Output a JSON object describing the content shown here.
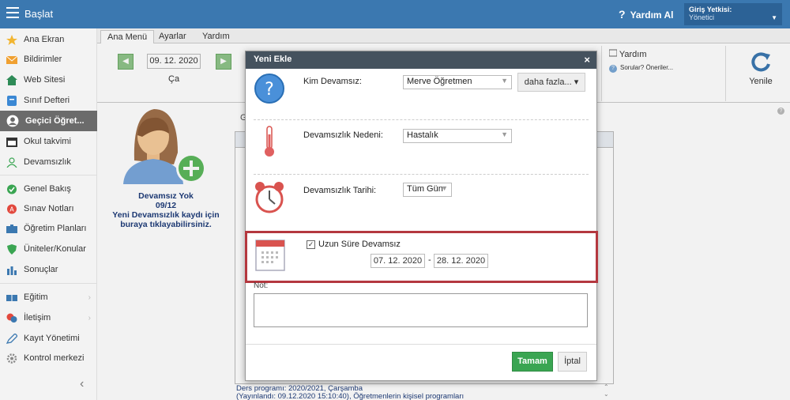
{
  "app": {
    "title": "Başlat",
    "help": "Yardım Al",
    "role_label": "Giriş Yetkisi:",
    "role_value": "Yönetici"
  },
  "sidebar": {
    "items": [
      {
        "label": "Ana Ekran",
        "icon": "star-icon"
      },
      {
        "label": "Bildirimler",
        "icon": "mail-icon"
      },
      {
        "label": "Web Sitesi",
        "icon": "home-icon"
      },
      {
        "label": "Sınıf Defteri",
        "icon": "notebook-icon"
      },
      {
        "label": "Geçici Öğret...",
        "icon": "person-icon"
      },
      {
        "label": "Okul takvimi",
        "icon": "calendar-icon"
      },
      {
        "label": "Devamsızlık",
        "icon": "user-outline-icon"
      },
      {
        "label": "Genel Bakış",
        "icon": "check-circle-icon"
      },
      {
        "label": "Sınav Notları",
        "icon": "grade-icon"
      },
      {
        "label": "Öğretim Planları",
        "icon": "briefcase-icon"
      },
      {
        "label": "Üniteler/Konular",
        "icon": "shield-icon"
      },
      {
        "label": "Sonuçlar",
        "icon": "bar-chart-icon"
      },
      {
        "label": "Eğitim",
        "icon": "book-icon"
      },
      {
        "label": "İletişim",
        "icon": "chat-icon"
      },
      {
        "label": "Kayıt Yönetimi",
        "icon": "pen-icon"
      },
      {
        "label": "Kontrol merkezi",
        "icon": "gear-icon"
      }
    ]
  },
  "tabs": [
    "Ana Menü",
    "Ayarlar",
    "Yardım"
  ],
  "toolbar": {
    "date": "09. 12. 2020",
    "day": "Ça",
    "help_title": "Yardım",
    "help_sub": "Sorular? Öneriler...",
    "refresh": "Yenile"
  },
  "content": {
    "absent_line1": "Devamsız Yok",
    "absent_line2": "09/12",
    "absent_line3": "Yeni Devamsızlık kaydı için",
    "absent_line4": "buraya tıklayabilirsiniz.",
    "g_letter": "G",
    "footer_line1": "Ders programı: 2020/2021, Çarşamba",
    "footer_line2": "(Yayınlandı: 09.12.2020 15:10:40), Öğretmenlerin kişisel programları"
  },
  "modal": {
    "title": "Yeni Ekle",
    "who_label": "Kim Devamsız:",
    "who_value": "Merve Öğretmen",
    "more_btn": "daha fazla... ▾",
    "reason_label": "Devamsızlık Nedeni:",
    "reason_value": "Hastalık",
    "date_label": "Devamsızlık Tarihi:",
    "date_value": "Tüm Gün",
    "long_label": "Uzun Süre Devamsız",
    "long_checked": true,
    "from": "07. 12. 2020",
    "dash": "-",
    "to": "28. 12. 2020",
    "note_label": "Not:",
    "ok": "Tamam",
    "cancel": "İptal"
  }
}
